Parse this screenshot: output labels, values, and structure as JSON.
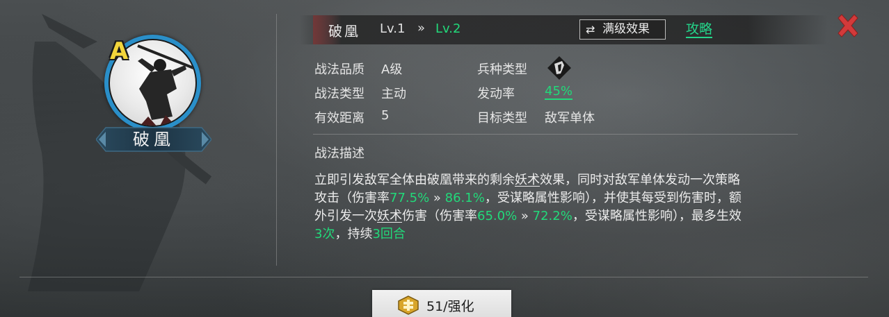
{
  "hero": {
    "grade": "A",
    "name": "破凰"
  },
  "header": {
    "skill_name": "破凰",
    "level_current": "Lv.1",
    "level_arrow": "»",
    "level_next": "Lv.2",
    "max_effect_label": "满级效果",
    "guide_label": "攻略"
  },
  "attributes": {
    "quality_label": "战法品质",
    "quality_value": "A级",
    "type_label": "战法类型",
    "type_value": "主动",
    "range_label": "有效距离",
    "range_value": "5",
    "troop_label": "兵种类型",
    "rate_label": "发动率",
    "rate_value": "45%",
    "target_label": "目标类型",
    "target_value": "敌军单体"
  },
  "description": {
    "title": "战法描述",
    "line1_a": "立即引发敌军全体由破凰带来的剩余",
    "line1_u": "妖术",
    "line1_b": "效果，同时对敌军单体发动一次策略",
    "line2_a": "攻击（伤害率",
    "line2_v1": "77.5%",
    "line2_arrow": " » ",
    "line2_v2": "86.1%",
    "line2_b": "，受谋略属性影响），并使其每受到伤害时，额",
    "line3_a": "外引发一次",
    "line3_u": "妖术",
    "line3_b": "伤害（伤害率",
    "line3_v1": "65.0%",
    "line3_arrow": " » ",
    "line3_v2": "72.2%",
    "line3_c": "，受谋略属性影响），最多生效",
    "line4_v1": "3次",
    "line4_a": "，持续",
    "line4_v2": "3回合"
  },
  "enhance": {
    "label": "51/强化"
  },
  "icons": {
    "close": "close-icon",
    "swap": "swap-icon",
    "troop": "troop-type-icon",
    "enhance": "enhance-icon"
  },
  "colors": {
    "accent_green": "#22d97a",
    "grade_yellow": "#f3d53b",
    "portrait_ring": "#2a8fc9",
    "close_red": "#d33a3a"
  }
}
